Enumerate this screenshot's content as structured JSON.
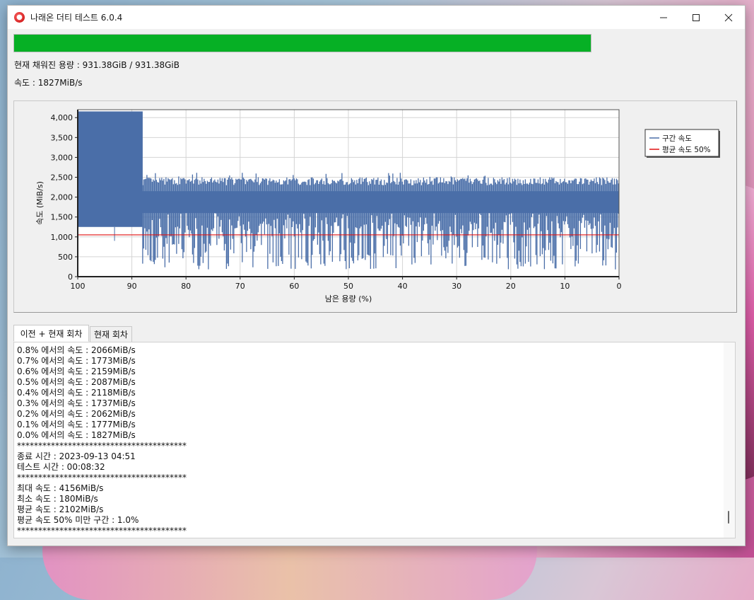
{
  "window": {
    "title": "나래온 더티 테스트 6.0.4",
    "controls": [
      "minimize",
      "maximize",
      "close"
    ]
  },
  "progress": {
    "fraction": 1.0,
    "color": "#06b025"
  },
  "info": {
    "capacity": "현재 채워진 용량 : 931.38GiB / 931.38GiB",
    "speed": "속도 : 1827MiB/s"
  },
  "chart_data": {
    "type": "area",
    "xlabel": "남은 용량 (%)",
    "ylabel": "속도 (MiB/s)",
    "xlim": [
      100,
      0
    ],
    "ylim": [
      0,
      4200
    ],
    "x_ticks": [
      "100",
      "90",
      "80",
      "70",
      "60",
      "50",
      "40",
      "30",
      "20",
      "10",
      "0"
    ],
    "y_ticks": [
      "0",
      "500",
      "1,000",
      "1,500",
      "2,000",
      "2,500",
      "3,000",
      "3,500",
      "4,000"
    ],
    "grid": true,
    "legend_position": "right",
    "series": [
      {
        "name": "구간 속도",
        "color": "#4a6ea8",
        "segments": [
          {
            "x": [
              100,
              88
            ],
            "max": 4156,
            "min": 1250
          },
          {
            "x": [
              88,
              0
            ],
            "max_range": [
              2300,
              2500
            ],
            "min_range": [
              180,
              1600
            ]
          }
        ]
      },
      {
        "name": "평균 속도 50%",
        "color": "#e01010",
        "value": 1051
      }
    ]
  },
  "tabs": [
    {
      "label": "이전 + 현재 회차",
      "active": true
    },
    {
      "label": "현재 회차",
      "active": false
    }
  ],
  "log": [
    "0.8% 에서의 속도 : 2066MiB/s",
    "0.7% 에서의 속도 : 1773MiB/s",
    "0.6% 에서의 속도 : 2159MiB/s",
    "0.5% 에서의 속도 : 2087MiB/s",
    "0.4% 에서의 속도 : 2118MiB/s",
    "0.3% 에서의 속도 : 1737MiB/s",
    "0.2% 에서의 속도 : 2062MiB/s",
    "0.1% 에서의 속도 : 1777MiB/s",
    "0.0% 에서의 속도 : 1827MiB/s",
    "****************************************",
    "종료 시간 : 2023-09-13 04:51",
    "테스트 시간 : 00:08:32",
    "****************************************",
    "최대 속도 : 4156MiB/s",
    "최소 속도 : 180MiB/s",
    "평균 속도 : 2102MiB/s",
    "평균 속도 50% 미만 구간 : 1.0%",
    "****************************************"
  ]
}
